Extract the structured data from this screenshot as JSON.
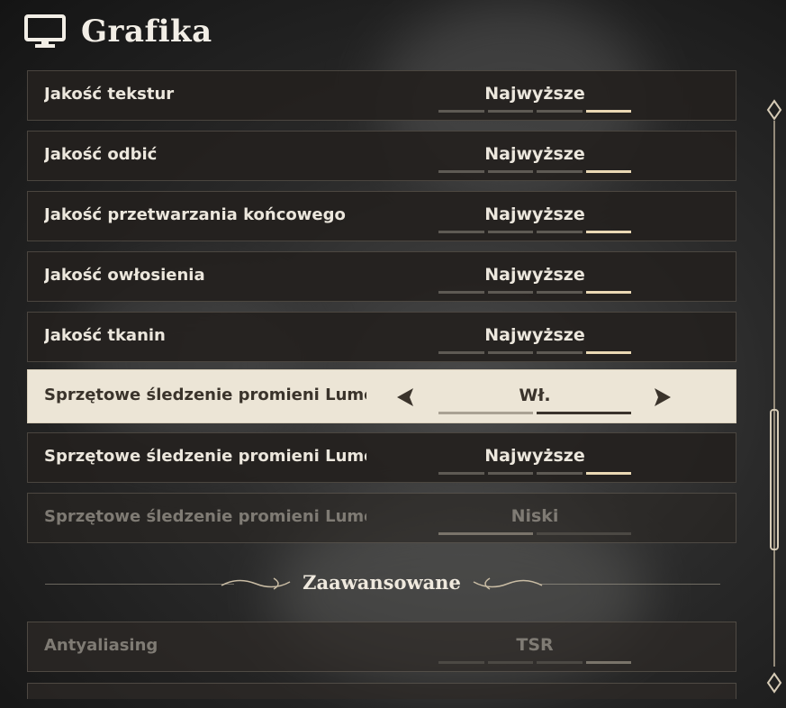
{
  "header": {
    "title": "Grafika",
    "icon": "monitor-icon"
  },
  "rows": [
    {
      "label": "Jakość tekstur",
      "value": "Najwyższe",
      "level": 4,
      "segments": 4
    },
    {
      "label": "Jakość odbić",
      "value": "Najwyższe",
      "level": 4,
      "segments": 4
    },
    {
      "label": "Jakość przetwarzania końcowego",
      "value": "Najwyższe",
      "level": 4,
      "segments": 4
    },
    {
      "label": "Jakość owłosienia",
      "value": "Najwyższe",
      "level": 4,
      "segments": 4
    },
    {
      "label": "Jakość tkanin",
      "value": "Najwyższe",
      "level": 4,
      "segments": 4
    },
    {
      "label": "Sprzętowe śledzenie promieni Lumen",
      "value": "Wł.",
      "level": 2,
      "segments": 2,
      "selected": true
    },
    {
      "label": "Sprzętowe śledzenie promieni Lumen",
      "value": "Najwyższe",
      "level": 4,
      "segments": 4
    },
    {
      "label": "Sprzętowe śledzenie promieni Lumen",
      "value": "Niski",
      "level": 2,
      "segments": 4,
      "disabled": true
    }
  ],
  "section": {
    "title": "Zaawansowane"
  },
  "advanced_rows": [
    {
      "label": "Antyaliasing",
      "value": "TSR",
      "level": 4,
      "segments": 4,
      "disabled": true
    }
  ],
  "colors": {
    "accent": "#ead8b4",
    "selected_bg": "#ece5d6",
    "row_bg": "#24211e"
  }
}
